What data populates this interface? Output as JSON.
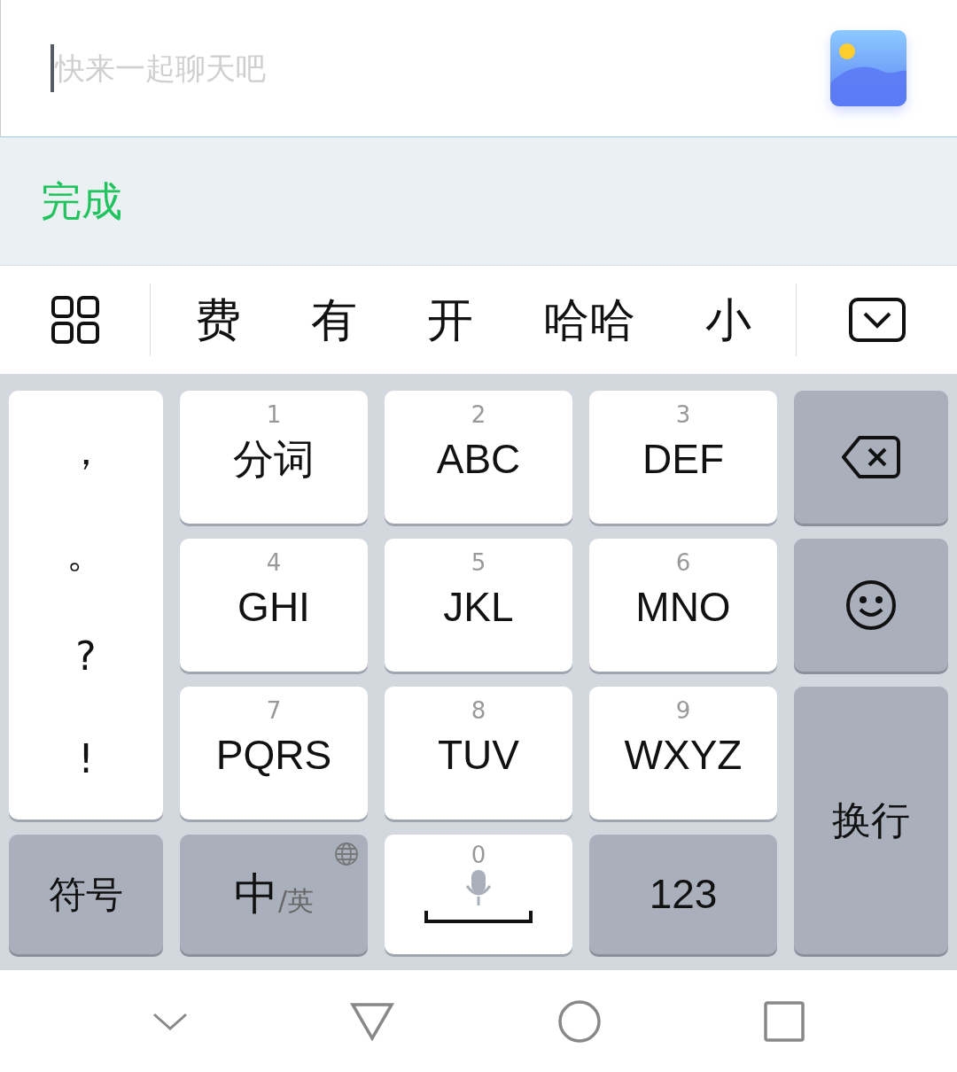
{
  "input": {
    "placeholder": "快来一起聊天吧"
  },
  "toolbar": {
    "done": "完成"
  },
  "candidates": [
    "费",
    "有",
    "开",
    "哈哈",
    "小"
  ],
  "punctuation": [
    "，",
    "。",
    "?",
    "!"
  ],
  "t9_keys": [
    {
      "digit": "1",
      "letters": "分词"
    },
    {
      "digit": "2",
      "letters": "ABC"
    },
    {
      "digit": "3",
      "letters": "DEF"
    },
    {
      "digit": "4",
      "letters": "GHI"
    },
    {
      "digit": "5",
      "letters": "JKL"
    },
    {
      "digit": "6",
      "letters": "MNO"
    },
    {
      "digit": "7",
      "letters": "PQRS"
    },
    {
      "digit": "8",
      "letters": "TUV"
    },
    {
      "digit": "9",
      "letters": "WXYZ"
    }
  ],
  "bottom_row": {
    "symbols": "符号",
    "language_main": "中",
    "language_alt": "/英",
    "space_digit": "0",
    "numbers": "123"
  },
  "enter": "换行"
}
